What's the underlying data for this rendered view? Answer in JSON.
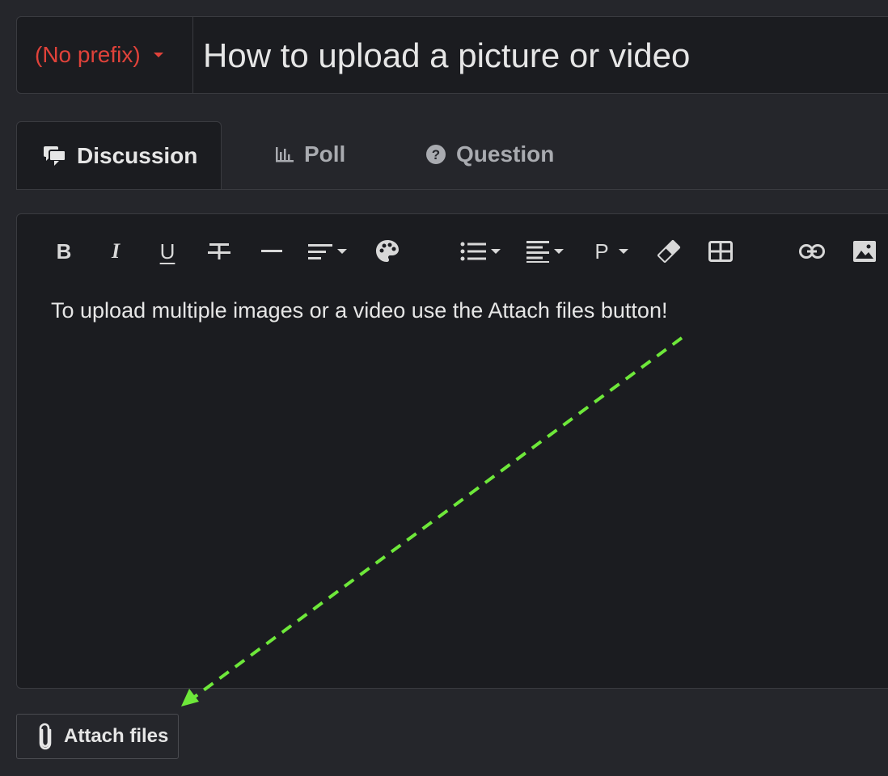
{
  "title_row": {
    "prefix_label": "(No prefix)",
    "title_value": "How to upload a picture or video"
  },
  "tabs": [
    {
      "label": "Discussion",
      "icon": "comments-icon",
      "active": true
    },
    {
      "label": "Poll",
      "icon": "bar-chart-icon",
      "active": false
    },
    {
      "label": "Question",
      "icon": "question-circle-icon",
      "active": false
    }
  ],
  "toolbar": {
    "bold": "B",
    "italic": "I",
    "underline": "U",
    "paragraph_format": "P",
    "buttons": [
      "bold-icon",
      "italic-icon",
      "underline-icon",
      "strikethrough-icon",
      "horizontal-line-icon",
      "inline-align-icon",
      "palette-icon",
      "list-icon",
      "align-icon",
      "paragraph-format-icon",
      "eraser-icon",
      "table-icon",
      "link-icon",
      "image-icon"
    ]
  },
  "editor": {
    "body_text": "To upload multiple images or a video use the Attach files button!"
  },
  "attach": {
    "label": "Attach files",
    "icon": "paperclip-icon"
  },
  "colors": {
    "background": "#25262b",
    "panel": "#1b1c20",
    "prefix_red": "#e0423a",
    "arrow_green": "#6ee83a"
  }
}
